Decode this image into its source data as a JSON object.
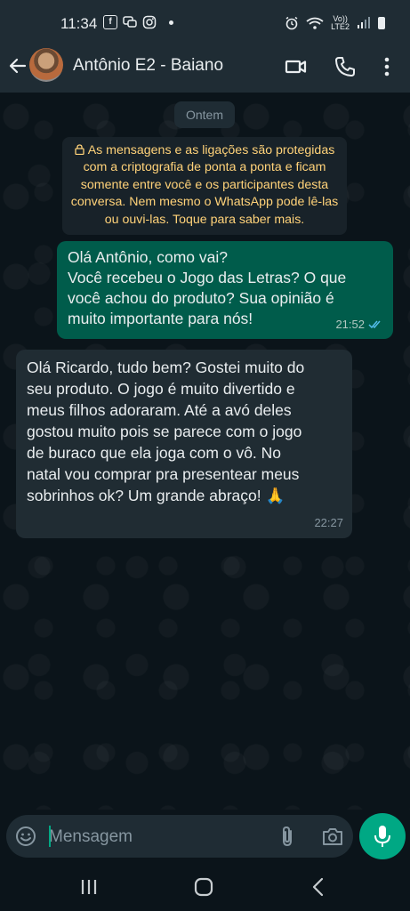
{
  "status_bar": {
    "time": "11:34",
    "lte_top": "Vo))",
    "lte_bottom": "LTE2"
  },
  "header": {
    "contact_name": "Antônio E2 - Baiano"
  },
  "chat": {
    "date_chip": "Ontem",
    "e2e_notice_lines": [
      "As mensagens e as ligações são protegidas",
      "com a criptografia de ponta a ponta e ficam",
      "somente entre você e os participantes desta",
      "conversa. Nem mesmo o WhatsApp pode lê-las",
      "ou ouvi-las. Toque para saber mais."
    ],
    "messages": [
      {
        "direction": "outgoing",
        "lines": [
          "Olá Antônio,  como vai?",
          "Você recebeu o Jogo das Letras? O que",
          "você achou do produto? Sua opinião é",
          "muito importante para nós!"
        ],
        "time": "21:52",
        "status": "read"
      },
      {
        "direction": "incoming",
        "lines": [
          "Olá Ricardo, tudo bem? Gostei muito do",
          "seu produto. O jogo é muito divertido e",
          "meus filhos adoraram. Até a avó deles",
          "gostou muito pois se parece com o jogo",
          "de buraco que ela joga com o vô. No",
          "natal vou comprar pra presentear meus",
          "sobrinhos ok? Um grande abraço! 🙏"
        ],
        "time": "22:27"
      }
    ]
  },
  "composer": {
    "placeholder": "Mensagem"
  },
  "colors": {
    "accent": "#00a884",
    "outgoing_bubble": "#005c4b",
    "incoming_bubble": "#202c33",
    "notice_text": "#ffd279",
    "read_ticks": "#53bdeb"
  },
  "icons": [
    "back-arrow-icon",
    "video-call-icon",
    "phone-icon",
    "more-options-icon",
    "lock-icon",
    "double-check-icon",
    "emoji-icon",
    "attach-icon",
    "camera-icon",
    "mic-icon"
  ]
}
